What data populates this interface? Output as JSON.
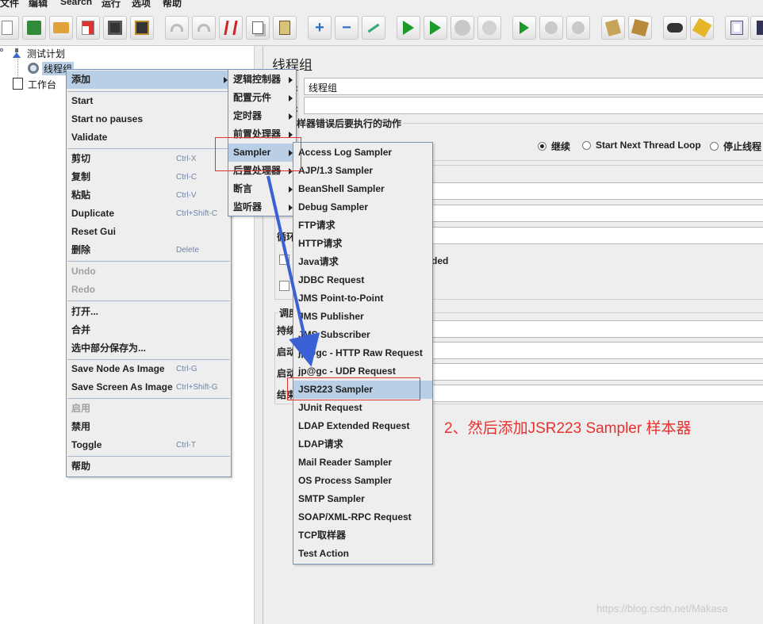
{
  "menubar": [
    "文件",
    "编辑",
    "Search",
    "运行",
    "选项",
    "帮助"
  ],
  "toolbar": {
    "icons": [
      "new-icon",
      "templates-icon",
      "open-icon",
      "close-icon",
      "save-icon",
      "save-as-icon",
      "undo-icon",
      "redo-icon",
      "cut-icon",
      "copy-icon",
      "paste-icon",
      "expand-icon",
      "collapse-icon",
      "toggle-icon",
      "start-icon",
      "start-no-pause-icon",
      "stop-icon",
      "shutdown-icon",
      "remote-start-icon",
      "remote-stop-icon",
      "remote-shutdown-icon",
      "clear-icon",
      "clear-all-icon",
      "search-icon",
      "reset-search-icon",
      "function-helper-icon",
      "help-icon"
    ]
  },
  "tree": {
    "nodes": [
      {
        "label": "测试计划"
      },
      {
        "label": "线程组"
      },
      {
        "label": "工作台"
      }
    ]
  },
  "panel": {
    "title": "线程组",
    "name_value": "线程组",
    "colon": ":",
    "action_section": "样器错误后要执行的动作",
    "radios": [
      {
        "label": "继续",
        "selected": true
      },
      {
        "label": "Start Next Thread Loop",
        "selected": false
      },
      {
        "label": "停止线程",
        "selected": false
      }
    ],
    "loop_label": "循环",
    "checkbox_text": "ded",
    "scheduler_label": "调度",
    "duration_label": "持续",
    "start_label_1": "启动",
    "start_label_2": "启动",
    "end_label": "结束"
  },
  "context_menu": {
    "items": [
      {
        "label": "添加",
        "shortcut": "",
        "disabled": false,
        "submenu": true,
        "highlighted": true
      },
      {
        "label": "Start",
        "shortcut": "",
        "disabled": false
      },
      {
        "label": "Start no pauses",
        "shortcut": "",
        "disabled": false
      },
      {
        "label": "Validate",
        "shortcut": "",
        "disabled": false
      },
      {
        "label": "剪切",
        "shortcut": "Ctrl-X",
        "disabled": false
      },
      {
        "label": "复制",
        "shortcut": "Ctrl-C",
        "disabled": false
      },
      {
        "label": "粘贴",
        "shortcut": "Ctrl-V",
        "disabled": false
      },
      {
        "label": "Duplicate",
        "shortcut": "Ctrl+Shift-C",
        "disabled": false
      },
      {
        "label": "Reset Gui",
        "shortcut": "",
        "disabled": false
      },
      {
        "label": "删除",
        "shortcut": "Delete",
        "disabled": false
      },
      {
        "label": "Undo",
        "shortcut": "",
        "disabled": true
      },
      {
        "label": "Redo",
        "shortcut": "",
        "disabled": true
      },
      {
        "label": "打开...",
        "shortcut": "",
        "disabled": false
      },
      {
        "label": "合并",
        "shortcut": "",
        "disabled": false
      },
      {
        "label": "选中部分保存为...",
        "shortcut": "",
        "disabled": false
      },
      {
        "label": "Save Node As Image",
        "shortcut": "Ctrl-G",
        "disabled": false
      },
      {
        "label": "Save Screen As Image",
        "shortcut": "Ctrl+Shift-G",
        "disabled": false
      },
      {
        "label": "启用",
        "shortcut": "",
        "disabled": true
      },
      {
        "label": "禁用",
        "shortcut": "",
        "disabled": false
      },
      {
        "label": "Toggle",
        "shortcut": "Ctrl-T",
        "disabled": false
      },
      {
        "label": "帮助",
        "shortcut": "",
        "disabled": false
      }
    ]
  },
  "add_submenu": {
    "items": [
      {
        "label": "逻辑控制器",
        "highlighted": false
      },
      {
        "label": "配置元件",
        "highlighted": false
      },
      {
        "label": "定时器",
        "highlighted": false
      },
      {
        "label": "前置处理器",
        "highlighted": false
      },
      {
        "label": "Sampler",
        "highlighted": true
      },
      {
        "label": "后置处理器",
        "highlighted": false
      },
      {
        "label": "断言",
        "highlighted": false
      },
      {
        "label": "监听器",
        "highlighted": false
      }
    ]
  },
  "sampler_submenu": {
    "items": [
      {
        "label": "Access Log Sampler",
        "highlighted": false
      },
      {
        "label": "AJP/1.3 Sampler",
        "highlighted": false
      },
      {
        "label": "BeanShell Sampler",
        "highlighted": false
      },
      {
        "label": "Debug Sampler",
        "highlighted": false
      },
      {
        "label": "FTP请求",
        "highlighted": false
      },
      {
        "label": "HTTP请求",
        "highlighted": false
      },
      {
        "label": "Java请求",
        "highlighted": false
      },
      {
        "label": "JDBC Request",
        "highlighted": false
      },
      {
        "label": "JMS Point-to-Point",
        "highlighted": false
      },
      {
        "label": "JMS Publisher",
        "highlighted": false
      },
      {
        "label": "JMS Subscriber",
        "highlighted": false
      },
      {
        "label": "jp@gc - HTTP Raw Request",
        "highlighted": false
      },
      {
        "label": "jp@gc - UDP Request",
        "highlighted": false
      },
      {
        "label": "JSR223 Sampler",
        "highlighted": true
      },
      {
        "label": "JUnit Request",
        "highlighted": false
      },
      {
        "label": "LDAP Extended Request",
        "highlighted": false
      },
      {
        "label": "LDAP请求",
        "highlighted": false
      },
      {
        "label": "Mail Reader Sampler",
        "highlighted": false
      },
      {
        "label": "OS Process Sampler",
        "highlighted": false
      },
      {
        "label": "SMTP Sampler",
        "highlighted": false
      },
      {
        "label": "SOAP/XML-RPC Request",
        "highlighted": false
      },
      {
        "label": "TCP取样器",
        "highlighted": false
      },
      {
        "label": "Test Action",
        "highlighted": false
      }
    ]
  },
  "annotation": {
    "text": "2、然后添加JSR223 Sampler 样本器",
    "color": "#e8312f",
    "arrow_color": "#3a62d6"
  },
  "watermark": "https://blog.csdn.net/Makasa"
}
